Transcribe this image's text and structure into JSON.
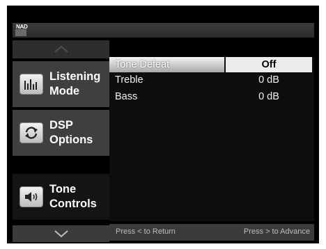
{
  "header": {
    "brand": "NAD"
  },
  "sidebar": {
    "items": [
      {
        "label": "Listening\nMode",
        "icon": "equalizer-bars-icon"
      },
      {
        "label": "DSP\nOptions",
        "icon": "refresh-arrows-icon"
      },
      {
        "label": "Tone\nControls",
        "icon": "speaker-volume-icon",
        "active": true
      }
    ],
    "scroll_up_icon": "chevron-up-icon",
    "scroll_down_icon": "chevron-down-icon"
  },
  "settings": {
    "rows": [
      {
        "label": "Tone Defeat",
        "value": "Off",
        "selected": true
      },
      {
        "label": "Treble",
        "value": "0 dB"
      },
      {
        "label": "Bass",
        "value": "0 dB"
      }
    ]
  },
  "footer": {
    "left_hint": "Press < to Return",
    "right_hint": "Press > to Advance"
  },
  "colors": {
    "screen_bg": "#000000",
    "panel": "#3f3f3f",
    "active_panel": "#141414",
    "highlight": "#ececec"
  }
}
